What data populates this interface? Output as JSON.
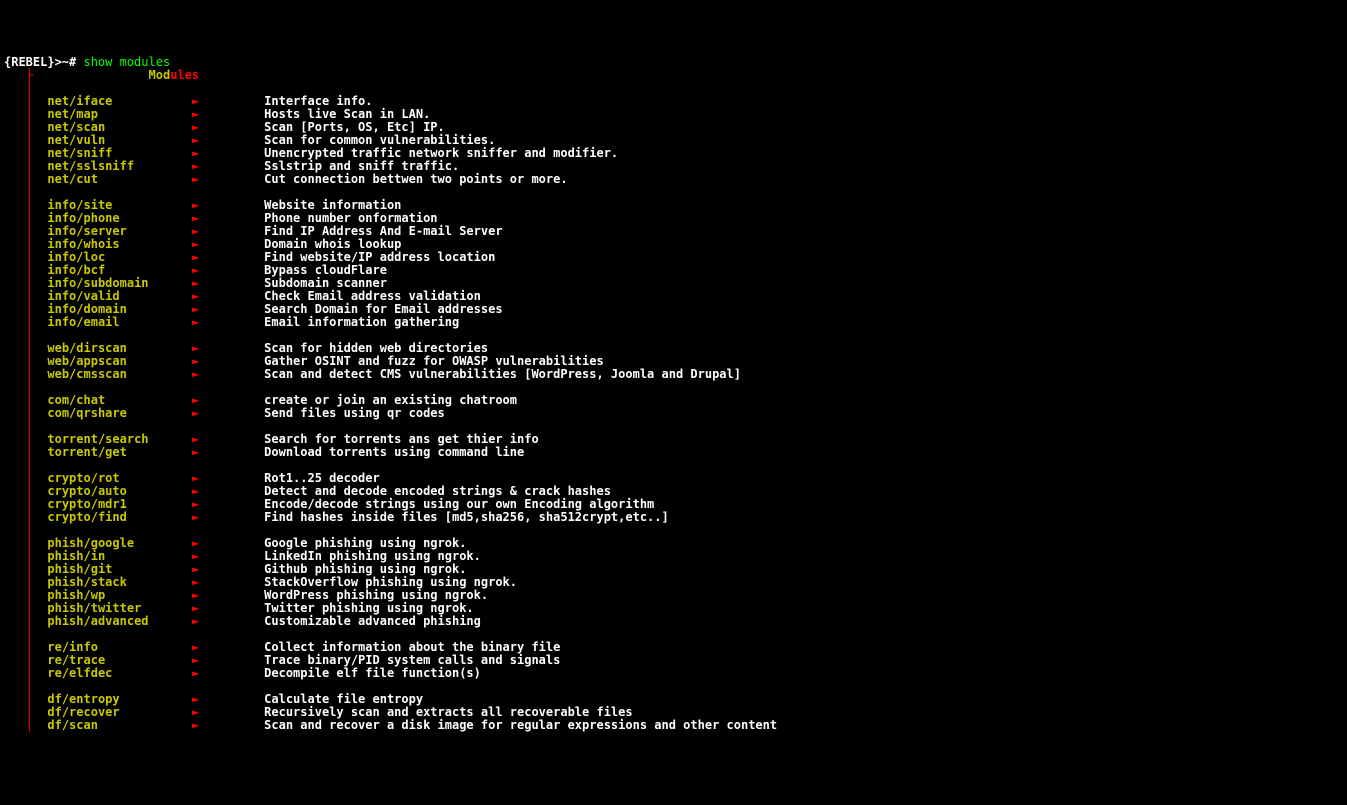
{
  "prompt": {
    "label": "{REBEL}>~#",
    "command": "show modules"
  },
  "header": {
    "left": "Mod",
    "right": "ules"
  },
  "sections": [
    [
      {
        "name": "net/iface",
        "desc": "Interface info."
      },
      {
        "name": "net/map",
        "desc": "Hosts live Scan in LAN."
      },
      {
        "name": "net/scan",
        "desc": "Scan [Ports, OS, Etc] IP."
      },
      {
        "name": "net/vuln",
        "desc": "Scan for common vulnerabilities."
      },
      {
        "name": "net/sniff",
        "desc": "Unencrypted traffic network sniffer and modifier."
      },
      {
        "name": "net/sslsniff",
        "desc": "Sslstrip and sniff traffic."
      },
      {
        "name": "net/cut",
        "desc": "Cut connection bettwen two points or more."
      }
    ],
    [
      {
        "name": "info/site",
        "desc": "Website information"
      },
      {
        "name": "info/phone",
        "desc": "Phone number onformation"
      },
      {
        "name": "info/server",
        "desc": "Find IP Address And E-mail Server"
      },
      {
        "name": "info/whois",
        "desc": "Domain whois lookup"
      },
      {
        "name": "info/loc",
        "desc": "Find website/IP address location"
      },
      {
        "name": "info/bcf",
        "desc": "Bypass cloudFlare"
      },
      {
        "name": "info/subdomain",
        "desc": "Subdomain scanner"
      },
      {
        "name": "info/valid",
        "desc": "Check Email address validation"
      },
      {
        "name": "info/domain",
        "desc": "Search Domain for Email addresses"
      },
      {
        "name": "info/email",
        "desc": "Email information gathering"
      }
    ],
    [
      {
        "name": "web/dirscan",
        "desc": "Scan for hidden web directories"
      },
      {
        "name": "web/appscan",
        "desc": "Gather OSINT and fuzz for OWASP vulnerabilities"
      },
      {
        "name": "web/cmsscan",
        "desc": "Scan and detect CMS vulnerabilities [WordPress, Joomla and Drupal]"
      }
    ],
    [
      {
        "name": "com/chat",
        "desc": "create or join an existing chatroom"
      },
      {
        "name": "com/qrshare",
        "desc": "Send files using qr codes"
      }
    ],
    [
      {
        "name": "torrent/search",
        "desc": "Search for torrents ans get thier info"
      },
      {
        "name": "torrent/get",
        "desc": "Download torrents using command line"
      }
    ],
    [
      {
        "name": "crypto/rot",
        "desc": "Rot1..25 decoder"
      },
      {
        "name": "crypto/auto",
        "desc": "Detect and decode encoded strings & crack hashes"
      },
      {
        "name": "crypto/mdr1",
        "desc": "Encode/decode strings using our own Encoding algorithm"
      },
      {
        "name": "crypto/find",
        "desc": "Find hashes inside files [md5,sha256, sha512crypt,etc..]"
      }
    ],
    [
      {
        "name": "phish/google",
        "desc": "Google phishing using ngrok."
      },
      {
        "name": "phish/in",
        "desc": "LinkedIn phishing using ngrok."
      },
      {
        "name": "phish/git",
        "desc": "Github phishing using ngrok."
      },
      {
        "name": "phish/stack",
        "desc": "StackOverflow phishing using ngrok."
      },
      {
        "name": "phish/wp",
        "desc": "WordPress phishing using ngrok."
      },
      {
        "name": "phish/twitter",
        "desc": "Twitter phishing using ngrok."
      },
      {
        "name": "phish/advanced",
        "desc": "Customizable advanced phishing"
      }
    ],
    [
      {
        "name": "re/info",
        "desc": "Collect information about the binary file"
      },
      {
        "name": "re/trace",
        "desc": "Trace binary/PID system calls and signals"
      },
      {
        "name": "re/elfdec",
        "desc": "Decompile elf file function(s)"
      }
    ],
    [
      {
        "name": "df/entropy",
        "desc": "Calculate file entropy"
      },
      {
        "name": "df/recover",
        "desc": "Recursively scan and extracts all recoverable files"
      },
      {
        "name": "df/scan",
        "desc": "Scan and recover a disk image for regular expressions and other content"
      }
    ]
  ],
  "glyphs": {
    "pipe": "│",
    "tee": "├",
    "arrow": "►"
  }
}
